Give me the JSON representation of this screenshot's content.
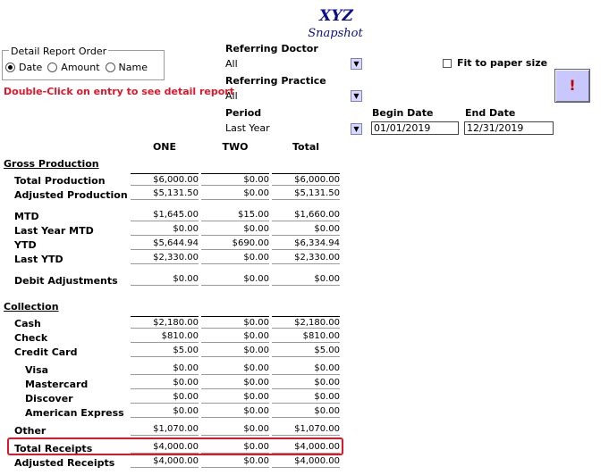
{
  "header": {
    "title": "XYZ",
    "subtitle": "Snapshot"
  },
  "report_order": {
    "legend": "Detail Report Order",
    "options": [
      "Date",
      "Amount",
      "Name"
    ],
    "selected": "Date"
  },
  "hint": "Double-Click on entry to see detail report",
  "filters": {
    "referring_doctor": {
      "label": "Referring Doctor",
      "value": "All"
    },
    "referring_practice": {
      "label": "Referring Practice",
      "value": "All"
    },
    "period": {
      "label": "Period",
      "value": "Last Year"
    },
    "begin_date": {
      "label": "Begin Date",
      "value": "01/01/2019"
    },
    "end_date": {
      "label": "End Date",
      "value": "12/31/2019"
    },
    "fit_to_paper": {
      "label": "Fit to paper size",
      "checked": false
    },
    "run_button": "!"
  },
  "columns": [
    "ONE",
    "TWO",
    "Total"
  ],
  "sections": {
    "gross_production": "Gross Production",
    "collection": "Collection"
  },
  "rows": {
    "total_production": {
      "label": "Total Production",
      "values": [
        "$6,000.00",
        "$0.00",
        "$6,000.00"
      ]
    },
    "adjusted_production": {
      "label": "Adjusted Production",
      "values": [
        "$5,131.50",
        "$0.00",
        "$5,131.50"
      ]
    },
    "mtd": {
      "label": "MTD",
      "values": [
        "$1,645.00",
        "$15.00",
        "$1,660.00"
      ]
    },
    "last_year_mtd": {
      "label": "Last Year MTD",
      "values": [
        "$0.00",
        "$0.00",
        "$0.00"
      ]
    },
    "ytd": {
      "label": "YTD",
      "values": [
        "$5,644.94",
        "$690.00",
        "$6,334.94"
      ]
    },
    "last_ytd": {
      "label": "Last YTD",
      "values": [
        "$2,330.00",
        "$0.00",
        "$2,330.00"
      ]
    },
    "debit_adjustments": {
      "label": "Debit Adjustments",
      "values": [
        "$0.00",
        "$0.00",
        "$0.00"
      ]
    },
    "cash": {
      "label": "Cash",
      "values": [
        "$2,180.00",
        "$0.00",
        "$2,180.00"
      ]
    },
    "check": {
      "label": "Check",
      "values": [
        "$810.00",
        "$0.00",
        "$810.00"
      ]
    },
    "credit_card": {
      "label": "Credit Card",
      "values": [
        "$5.00",
        "$0.00",
        "$5.00"
      ]
    },
    "visa": {
      "label": "Visa",
      "values": [
        "$0.00",
        "$0.00",
        "$0.00"
      ]
    },
    "mastercard": {
      "label": "Mastercard",
      "values": [
        "$0.00",
        "$0.00",
        "$0.00"
      ]
    },
    "discover": {
      "label": "Discover",
      "values": [
        "$0.00",
        "$0.00",
        "$0.00"
      ]
    },
    "american_express": {
      "label": "American Express",
      "values": [
        "$0.00",
        "$0.00",
        "$0.00"
      ]
    },
    "other": {
      "label": "Other",
      "values": [
        "$1,070.00",
        "$0.00",
        "$1,070.00"
      ]
    },
    "total_receipts": {
      "label": "Total Receipts",
      "values": [
        "$4,000.00",
        "$0.00",
        "$4,000.00"
      ]
    },
    "adjusted_receipts": {
      "label": "Adjusted Receipts",
      "values": [
        "$4,000.00",
        "$0.00",
        "$4,000.00"
      ]
    }
  },
  "colors": {
    "title": "#0b0f8f",
    "hint": "#e0162a",
    "highlight": "#e0162a"
  }
}
